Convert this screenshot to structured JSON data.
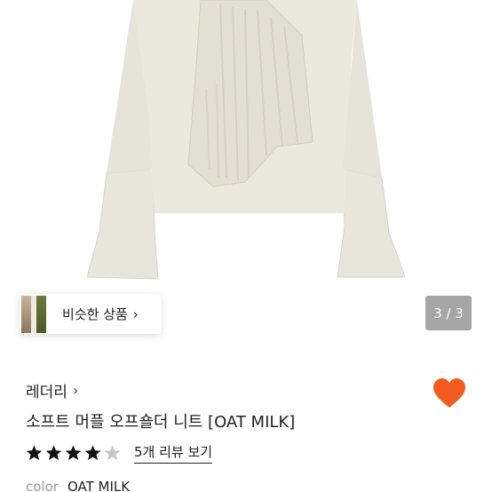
{
  "product": {
    "image_alt": "knit sweater photo",
    "page_indicator": "3 / 3",
    "similar_products_label": "비슷한 상품",
    "similar_chevron": "›",
    "brand": "레더리",
    "brand_chevron": "›",
    "title": "소프트 머플 오프숄더 니트 [OAT MILK]",
    "rating": 4,
    "rating_max": 5,
    "review_link": "5개 리뷰 보기",
    "color_label": "color",
    "color_value": "OAT MILK",
    "favorited": true
  },
  "colors": {
    "heart": "#f25a1e",
    "star_filled": "#111111",
    "star_empty": "#c8c8c8",
    "indicator_bg": "#a6a6a6",
    "knit": "#e9e6dc"
  }
}
